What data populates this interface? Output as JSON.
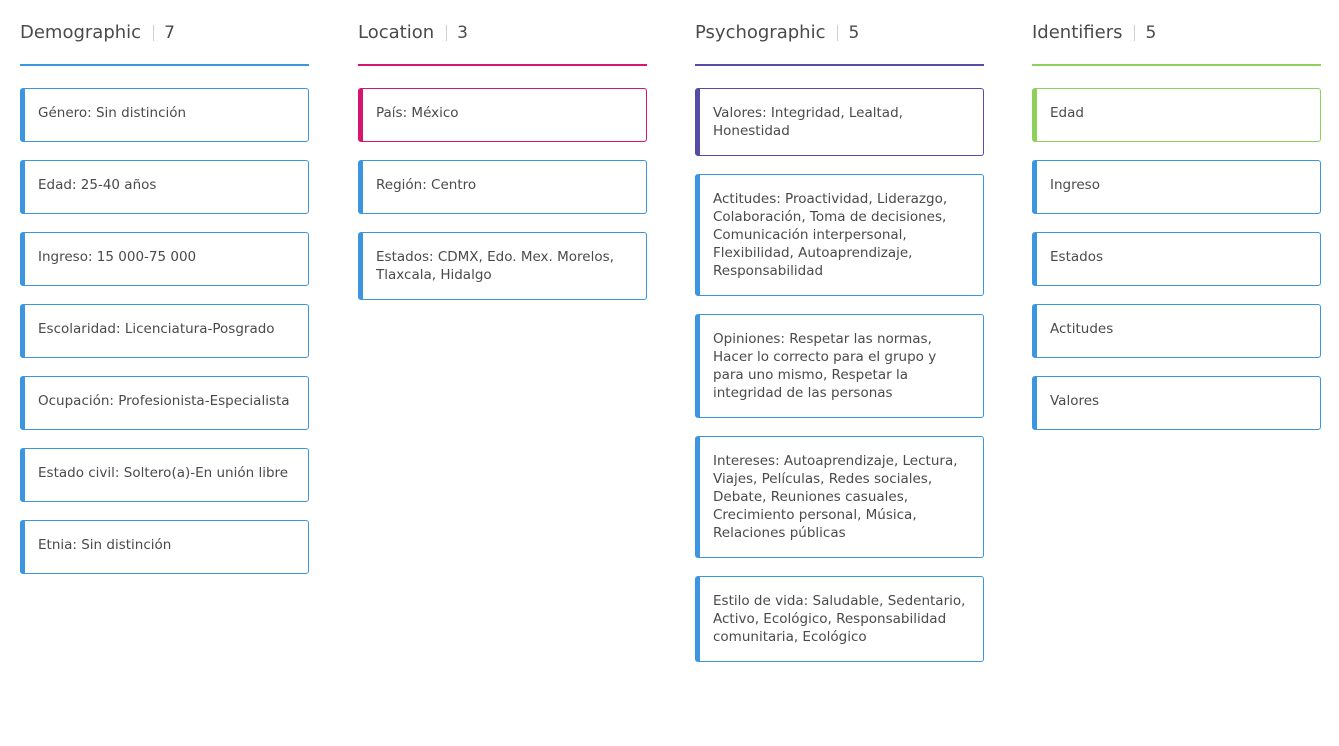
{
  "columns": [
    {
      "title": "Demographic",
      "count": "7",
      "accent": "#3b95e0",
      "cards": [
        {
          "text": "Género: Sin distinción"
        },
        {
          "text": "Edad: 25-40 años"
        },
        {
          "text": "Ingreso: 15 000-75 000"
        },
        {
          "text": "Escolaridad: Licenciatura-Posgrado"
        },
        {
          "text": "Ocupación: Profesionista-Especialista"
        },
        {
          "text": "Estado civil: Soltero(a)-En unión libre"
        },
        {
          "text": "Etnia: Sin distinción"
        }
      ]
    },
    {
      "title": "Location",
      "count": "3",
      "accent": "#d6166e",
      "cards": [
        {
          "text": "País: México"
        },
        {
          "text": "Región: Centro"
        },
        {
          "text": "Estados: CDMX, Edo. Mex. Morelos, Tlaxcala, Hidalgo"
        }
      ]
    },
    {
      "title": "Psychographic",
      "count": "5",
      "accent": "#554ca8",
      "cards": [
        {
          "text": "Valores: Integridad, Lealtad, Honestidad"
        },
        {
          "text": "Actitudes: Proactividad, Liderazgo, Colaboración, Toma de decisiones, Comunicación interpersonal, Flexibilidad, Autoaprendizaje, Responsabilidad"
        },
        {
          "text": "Opiniones: Respetar las normas, Hacer lo correcto para el grupo y para uno mismo, Respetar la integridad de las personas"
        },
        {
          "text": "Intereses: Autoaprendizaje, Lectura, Viajes, Películas, Redes sociales, Debate, Reuniones casuales, Crecimiento personal, Música, Relaciones públicas"
        },
        {
          "text": "Estilo de vida: Saludable, Sedentario, Activo, Ecológico, Responsabilidad comunitaria, Ecológico"
        }
      ]
    },
    {
      "title": "Identifiers",
      "count": "5",
      "accent": "#8fd05a",
      "cards": [
        {
          "text": "Edad"
        },
        {
          "text": "Ingreso"
        },
        {
          "text": "Estados"
        },
        {
          "text": "Actitudes"
        },
        {
          "text": "Valores"
        }
      ]
    }
  ]
}
